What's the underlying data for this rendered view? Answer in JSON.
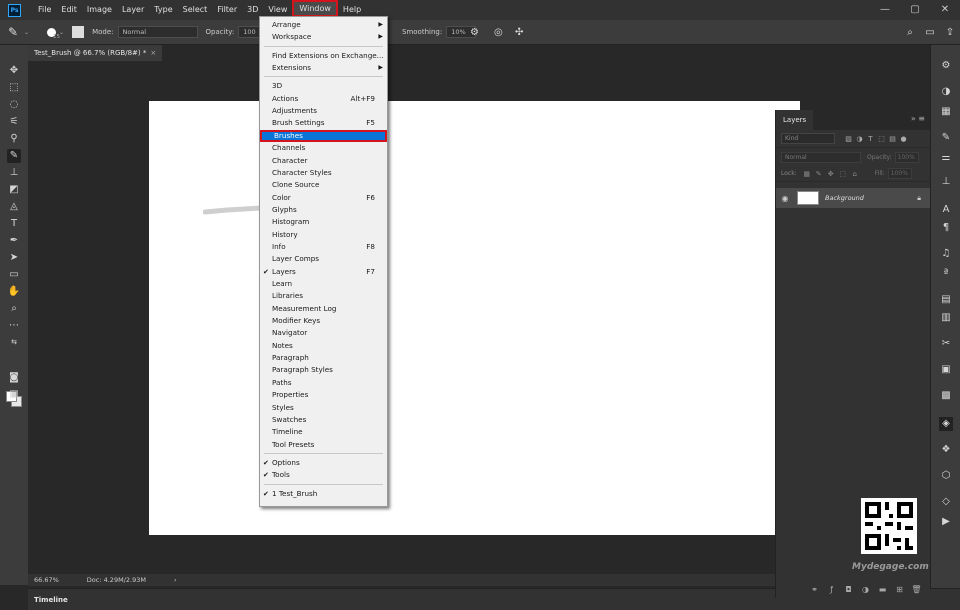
{
  "menubar": {
    "logo": "Ps",
    "items": [
      "File",
      "Edit",
      "Image",
      "Layer",
      "Type",
      "Select",
      "Filter",
      "3D",
      "View",
      "Window",
      "Help"
    ],
    "active_index": 9,
    "window_controls": [
      "—",
      "▢",
      "✕"
    ]
  },
  "options": {
    "brush_size": "15",
    "mode_label": "Mode:",
    "mode_value": "Normal",
    "opacity_label": "Opacity:",
    "opacity_value": "100",
    "smoothing_label": "Smoothing:",
    "smoothing_value": "10%"
  },
  "document": {
    "tab_title": "Test_Brush @ 66.7% (RGB/8#) *",
    "tab_close": "×"
  },
  "status": {
    "zoom": "66.67%",
    "doc": "Doc: 4.29M/2.93M",
    "arrow": "›"
  },
  "timeline_label": "Timeline",
  "layers": {
    "tab_label": "Layers",
    "kind_placeholder": "Kind",
    "blend_mode": "Normal",
    "opacity_label": "Opacity:",
    "opacity_value": "100%",
    "lock_label": "Lock:",
    "fill_label": "Fill:",
    "fill_value": "100%",
    "layer_name": "Background"
  },
  "watermark": "Mydegage.com",
  "window_menu": {
    "items": [
      {
        "label": "Arrange",
        "submenu": true
      },
      {
        "label": "Workspace",
        "submenu": true
      },
      {
        "separator": true
      },
      {
        "label": "Find Extensions on Exchange..."
      },
      {
        "label": "Extensions",
        "submenu": true
      },
      {
        "separator": true
      },
      {
        "label": "3D"
      },
      {
        "label": "Actions",
        "shortcut": "Alt+F9"
      },
      {
        "label": "Adjustments"
      },
      {
        "label": "Brush Settings",
        "shortcut": "F5"
      },
      {
        "label": "Brushes",
        "highlight": true
      },
      {
        "label": "Channels"
      },
      {
        "label": "Character"
      },
      {
        "label": "Character Styles"
      },
      {
        "label": "Clone Source"
      },
      {
        "label": "Color",
        "shortcut": "F6"
      },
      {
        "label": "Glyphs"
      },
      {
        "label": "Histogram"
      },
      {
        "label": "History"
      },
      {
        "label": "Info",
        "shortcut": "F8"
      },
      {
        "label": "Layer Comps"
      },
      {
        "label": "Layers",
        "shortcut": "F7",
        "checked": true
      },
      {
        "label": "Learn"
      },
      {
        "label": "Libraries"
      },
      {
        "label": "Measurement Log"
      },
      {
        "label": "Modifier Keys"
      },
      {
        "label": "Navigator"
      },
      {
        "label": "Notes"
      },
      {
        "label": "Paragraph"
      },
      {
        "label": "Paragraph Styles"
      },
      {
        "label": "Paths"
      },
      {
        "label": "Properties"
      },
      {
        "label": "Styles"
      },
      {
        "label": "Swatches"
      },
      {
        "label": "Timeline"
      },
      {
        "label": "Tool Presets"
      },
      {
        "separator": true
      },
      {
        "label": "Options",
        "checked": true
      },
      {
        "label": "Tools",
        "checked": true
      },
      {
        "separator": true
      },
      {
        "label": "1 Test_Brush",
        "checked": true
      }
    ]
  }
}
